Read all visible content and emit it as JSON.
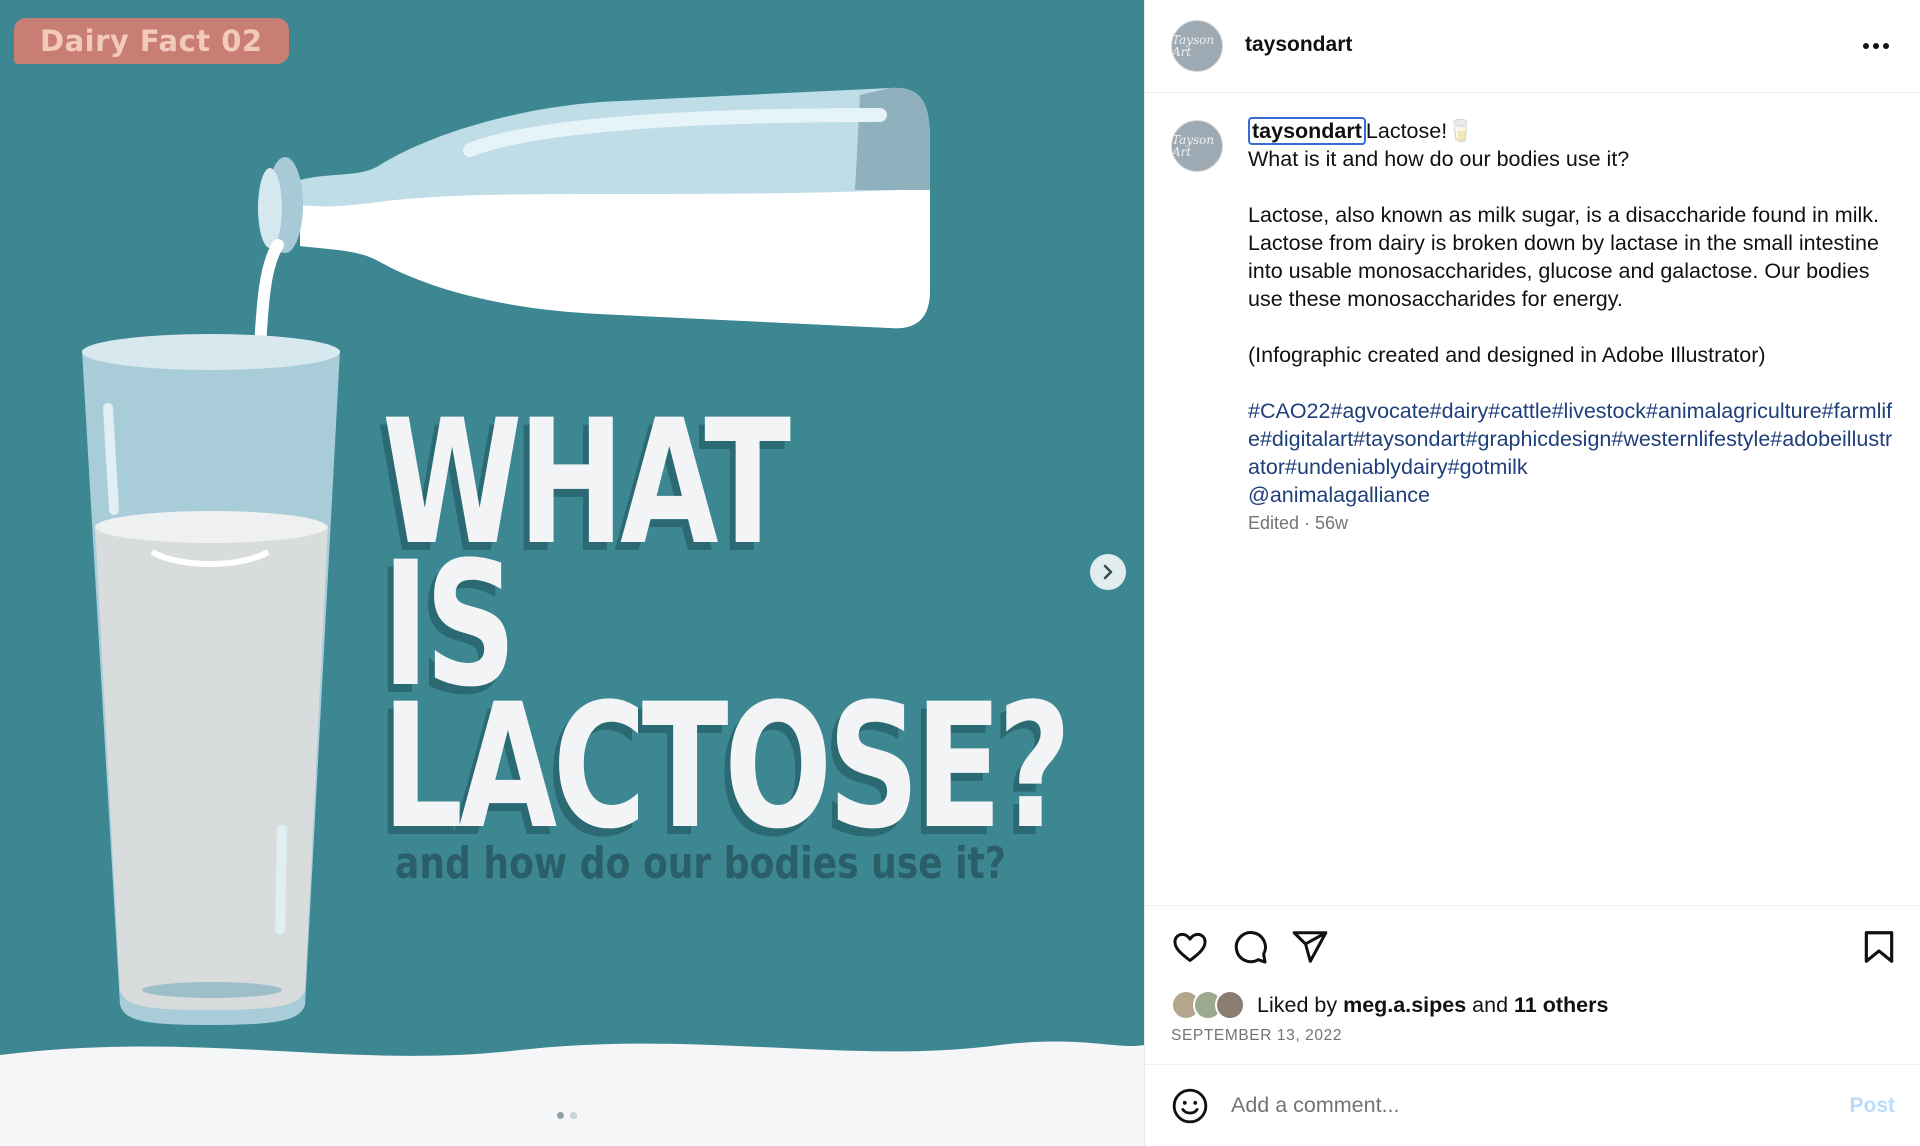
{
  "image": {
    "badge": "Dairy Fact 02",
    "headline": [
      "WHAT",
      "IS",
      "LACTOSE?"
    ],
    "subline": "and how do our bodies use it?",
    "background_color": "#3d8793",
    "carousel_dots": 2,
    "active_dot": 0
  },
  "header": {
    "username": "taysondart",
    "avatar_initials": "Tayson Art"
  },
  "caption": {
    "username": "taysondart",
    "title": "Lactose!🥛",
    "line2": "What is it and how do our bodies use it?",
    "paragraph": "Lactose, also known as milk sugar, is a disaccharide found in milk. Lactose from dairy is broken down by lactase in the small intestine into usable monosaccharides, glucose and galactose. Our bodies use these monosaccharides for energy.",
    "note": "(Infographic created and designed in Adobe Illustrator)",
    "hashtags": "#CAO22#agvocate#dairy#cattle#livestock#animalagriculture#farmlife#digitalart#taysondart#graphicdesign#westernlifestyle#adobeillustrator#undeniablydairy#gotmilk",
    "mention": "@animalagalliance",
    "edited": "Edited · 56w"
  },
  "likes": {
    "prefix": "Liked by",
    "user": "meg.a.sipes",
    "middle": "and",
    "others": "11 others"
  },
  "date": "SEPTEMBER 13, 2022",
  "comment": {
    "placeholder": "Add a comment...",
    "post_label": "Post"
  },
  "icons": [
    "more-icon",
    "heart-icon",
    "comment-icon",
    "share-icon",
    "bookmark-icon",
    "emoji-icon",
    "chevron-right-icon"
  ],
  "colors": {
    "link": "#1f3f7a",
    "post_disabled": "#b9dcfb",
    "muted": "#737373"
  }
}
